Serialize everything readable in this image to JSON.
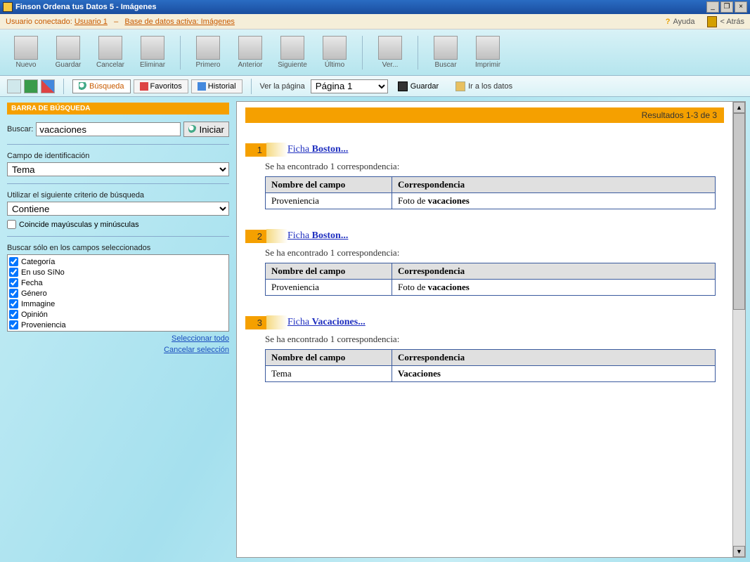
{
  "window": {
    "title": "Finson Ordena tus Datos 5 - Imágenes"
  },
  "status": {
    "user_label": "Usuario conectado:",
    "user": "Usuario 1",
    "sep": "–",
    "db_label": "Base de datos activa: Imágenes",
    "help": "Ayuda",
    "back": "< Atrás"
  },
  "toolbar1": {
    "items": [
      {
        "label": "Nuevo"
      },
      {
        "label": "Guardar"
      },
      {
        "label": "Cancelar"
      },
      {
        "label": "Eliminar"
      },
      {
        "sep": true
      },
      {
        "label": "Primero"
      },
      {
        "label": "Anterior"
      },
      {
        "label": "Siguiente"
      },
      {
        "label": "Último"
      },
      {
        "sep": true
      },
      {
        "label": "Ver..."
      },
      {
        "sep": true
      },
      {
        "label": "Buscar"
      },
      {
        "label": "Imprimir"
      }
    ]
  },
  "toolbar2": {
    "busqueda": "Búsqueda",
    "favoritos": "Favoritos",
    "historial": "Historial",
    "ver_pagina": "Ver la página",
    "page_sel": "Página 1",
    "guardar": "Guardar",
    "ir_datos": "Ir a los datos"
  },
  "sidebar": {
    "header": "BARRA DE BÚSQUEDA",
    "buscar_label": "Buscar:",
    "buscar_value": "vacaciones",
    "iniciar": "Iniciar",
    "campo_id_label": "Campo de identificación",
    "campo_id_value": "Tema",
    "criterio_label": "Utilizar el siguiente criterio de búsqueda",
    "criterio_value": "Contiene",
    "mayus_label": "Coincide mayúsculas y minúsculas",
    "campos_label": "Buscar sólo en los campos seleccionados",
    "fields": [
      "Categoría",
      "En uso SíNo",
      "Fecha",
      "Género",
      "Immagine",
      "Opinión",
      "Proveniencia"
    ],
    "sel_all": "Seleccionar todo",
    "cancel_sel": "Cancelar selección"
  },
  "results": {
    "header": "Resultados 1-3 de 3",
    "msg": "Se ha encontrado 1 correspondencia:",
    "th1": "Nombre del campo",
    "th2": "Correspondencia",
    "items": [
      {
        "n": "1",
        "link_pre": "Ficha ",
        "link_b": "Boston...",
        "field": "Proveniencia",
        "match_pre": "Foto de ",
        "match_b": "vacaciones"
      },
      {
        "n": "2",
        "link_pre": "Ficha ",
        "link_b": "Boston...",
        "field": "Proveniencia",
        "match_pre": "Foto de ",
        "match_b": "vacaciones"
      },
      {
        "n": "3",
        "link_pre": "Ficha ",
        "link_b": "Vacaciones...",
        "field": "Tema",
        "match_pre": "",
        "match_b": "Vacaciones"
      }
    ]
  }
}
